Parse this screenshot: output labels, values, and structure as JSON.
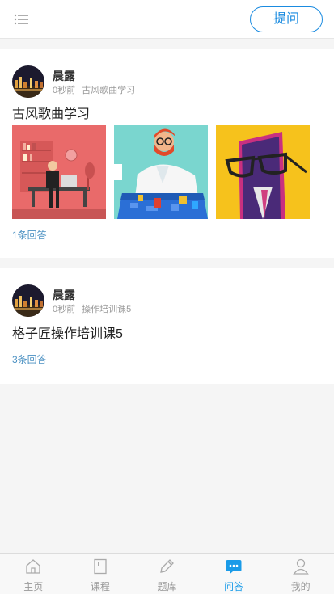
{
  "header": {
    "ask_label": "提问"
  },
  "questions": [
    {
      "user": "晨露",
      "time": "0秒前",
      "tag": "古风歌曲学习",
      "title": "古风歌曲学习",
      "answers": "1条回答"
    },
    {
      "user": "晨露",
      "time": "0秒前",
      "tag": "操作培训课5",
      "title": "格子匠操作培训课5",
      "answers": "3条回答"
    }
  ],
  "tabs": [
    {
      "label": "主页",
      "icon": "home-icon"
    },
    {
      "label": "课程",
      "icon": "book-icon"
    },
    {
      "label": "题库",
      "icon": "pencil-icon"
    },
    {
      "label": "问答",
      "icon": "chat-icon",
      "active": true
    },
    {
      "label": "我的",
      "icon": "user-icon"
    }
  ],
  "colors": {
    "accent": "#1a8be0",
    "tab_active": "#1a9be8",
    "answer_link": "#4a90c2",
    "background": "#f5f5f5"
  }
}
